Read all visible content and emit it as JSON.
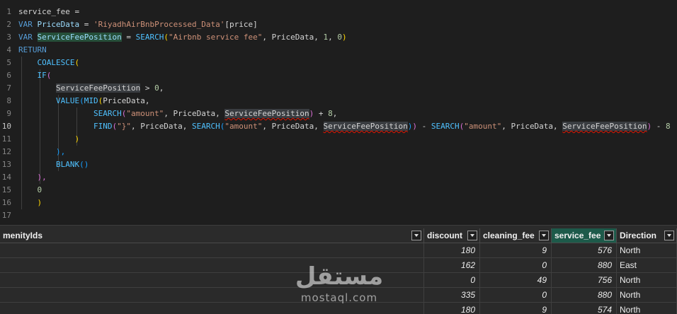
{
  "editor": {
    "lines": [
      {
        "n": "1",
        "tokens": [
          {
            "t": "service_fee = ",
            "c": ""
          }
        ]
      },
      {
        "n": "2",
        "tokens": [
          {
            "t": "VAR ",
            "c": "kw"
          },
          {
            "t": "PriceData",
            "c": "var"
          },
          {
            "t": " = ",
            "c": ""
          },
          {
            "t": "'RiyadhAirBnbProcessed_Data'",
            "c": "str"
          },
          {
            "t": "[price]",
            "c": ""
          }
        ]
      },
      {
        "n": "3",
        "tokens": [
          {
            "t": "VAR ",
            "c": "kw"
          },
          {
            "t": "ServiceFeePosition",
            "c": "var hl-green"
          },
          {
            "t": " = ",
            "c": ""
          },
          {
            "t": "SEARCH",
            "c": "fn"
          },
          {
            "t": "(",
            "c": "br1"
          },
          {
            "t": "\"Airbnb service fee\"",
            "c": "str"
          },
          {
            "t": ", PriceData, ",
            "c": ""
          },
          {
            "t": "1",
            "c": "num"
          },
          {
            "t": ", ",
            "c": ""
          },
          {
            "t": "0",
            "c": "num"
          },
          {
            "t": ")",
            "c": "br1"
          }
        ]
      },
      {
        "n": "4",
        "tokens": [
          {
            "t": "RETURN",
            "c": "kw"
          }
        ]
      },
      {
        "n": "5",
        "tokens": [
          {
            "t": "    COALESCE",
            "c": "fn"
          },
          {
            "t": "(",
            "c": "br1"
          }
        ]
      },
      {
        "n": "6",
        "tokens": [
          {
            "t": "    IF",
            "c": "fn"
          },
          {
            "t": "(",
            "c": "br2"
          }
        ]
      },
      {
        "n": "7",
        "tokens": [
          {
            "t": "        ",
            "c": ""
          },
          {
            "t": "ServiceFeePosition",
            "c": "hl"
          },
          {
            "t": " > ",
            "c": ""
          },
          {
            "t": "0",
            "c": "num"
          },
          {
            "t": ",",
            "c": ""
          }
        ]
      },
      {
        "n": "8",
        "tokens": [
          {
            "t": "        VALUE",
            "c": "fn"
          },
          {
            "t": "(",
            "c": "br3"
          },
          {
            "t": "MID",
            "c": "fn"
          },
          {
            "t": "(",
            "c": "br1"
          },
          {
            "t": "PriceData,",
            "c": ""
          }
        ]
      },
      {
        "n": "9",
        "tokens": [
          {
            "t": "                SEARCH",
            "c": "fn"
          },
          {
            "t": "(",
            "c": "br2"
          },
          {
            "t": "\"amount\"",
            "c": "str"
          },
          {
            "t": ", PriceData, ",
            "c": ""
          },
          {
            "t": "ServiceFeePosition",
            "c": "hl err"
          },
          {
            "t": ")",
            "c": "br2"
          },
          {
            "t": " + ",
            "c": ""
          },
          {
            "t": "8",
            "c": "num"
          },
          {
            "t": ",",
            "c": ""
          }
        ]
      },
      {
        "n": "10",
        "tokens": [
          {
            "t": "                FIND",
            "c": "fn"
          },
          {
            "t": "(",
            "c": "br2"
          },
          {
            "t": "\"}\"",
            "c": "str"
          },
          {
            "t": ", PriceData, ",
            "c": ""
          },
          {
            "t": "SEARCH",
            "c": "fn"
          },
          {
            "t": "(",
            "c": "br3"
          },
          {
            "t": "\"amount\"",
            "c": "str"
          },
          {
            "t": ", PriceData, ",
            "c": ""
          },
          {
            "t": "ServiceFeePosition",
            "c": "hl err"
          },
          {
            "t": ")",
            "c": "br3"
          },
          {
            "t": ")",
            "c": "br2"
          },
          {
            "t": " - ",
            "c": ""
          },
          {
            "t": "SEARCH",
            "c": "fn"
          },
          {
            "t": "(",
            "c": "br2"
          },
          {
            "t": "\"amount\"",
            "c": "str"
          },
          {
            "t": ", PriceData, ",
            "c": ""
          },
          {
            "t": "ServiceFeePosition",
            "c": "hl err"
          },
          {
            "t": ")",
            "c": "br2"
          },
          {
            "t": " - ",
            "c": ""
          },
          {
            "t": "8",
            "c": "num"
          }
        ]
      },
      {
        "n": "11",
        "tokens": [
          {
            "t": "            )",
            "c": "br1"
          }
        ]
      },
      {
        "n": "12",
        "tokens": [
          {
            "t": "        ),",
            "c": "br3"
          }
        ]
      },
      {
        "n": "13",
        "tokens": [
          {
            "t": "        BLANK",
            "c": "fn"
          },
          {
            "t": "()",
            "c": "br3"
          }
        ]
      },
      {
        "n": "14",
        "tokens": [
          {
            "t": "    ),",
            "c": "br2"
          }
        ]
      },
      {
        "n": "15",
        "tokens": [
          {
            "t": "    ",
            "c": ""
          },
          {
            "t": "0",
            "c": "num"
          }
        ]
      },
      {
        "n": "16",
        "tokens": [
          {
            "t": "    )",
            "c": "br1"
          }
        ]
      },
      {
        "n": "17",
        "tokens": []
      }
    ],
    "active_line": "10"
  },
  "grid": {
    "columns": [
      {
        "key": "amenityIds",
        "label": "menityIds"
      },
      {
        "key": "discount",
        "label": "discount"
      },
      {
        "key": "cleaning_fee",
        "label": "cleaning_fee"
      },
      {
        "key": "service_fee",
        "label": "service_fee",
        "selected": true
      },
      {
        "key": "direction",
        "label": "Direction"
      }
    ],
    "rows": [
      {
        "amenityIds": "",
        "discount": "180",
        "cleaning_fee": "9",
        "service_fee": "576",
        "direction": "North"
      },
      {
        "amenityIds": "",
        "discount": "162",
        "cleaning_fee": "0",
        "service_fee": "880",
        "direction": "East"
      },
      {
        "amenityIds": "",
        "discount": "0",
        "cleaning_fee": "49",
        "service_fee": "756",
        "direction": "North"
      },
      {
        "amenityIds": "",
        "discount": "335",
        "cleaning_fee": "0",
        "service_fee": "880",
        "direction": "North"
      },
      {
        "amenityIds": "",
        "discount": "180",
        "cleaning_fee": "9",
        "service_fee": "574",
        "direction": "North"
      }
    ]
  },
  "watermark": {
    "arabic": "مستقل",
    "latin": "mostaql.com"
  }
}
